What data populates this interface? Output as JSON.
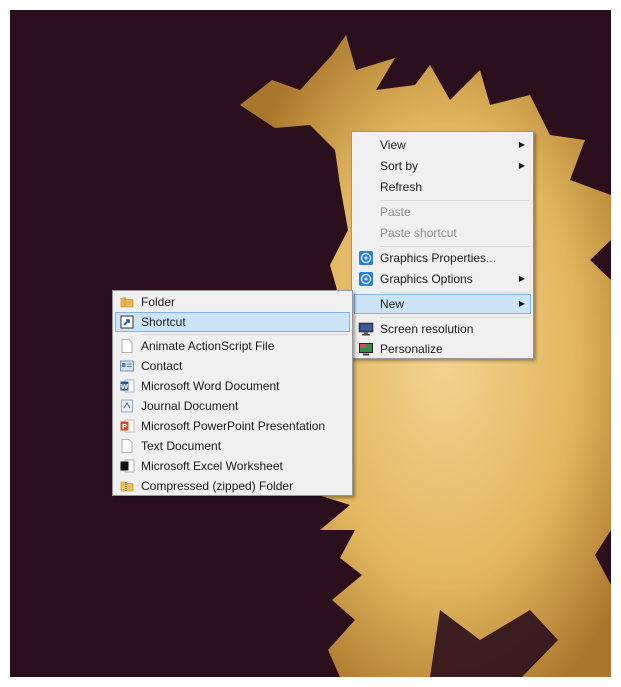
{
  "context_menu": {
    "items": [
      {
        "label": "View",
        "has_submenu": true,
        "enabled": true
      },
      {
        "label": "Sort by",
        "has_submenu": true,
        "enabled": true
      },
      {
        "label": "Refresh",
        "has_submenu": false,
        "enabled": true
      },
      {
        "label": "Paste",
        "has_submenu": false,
        "enabled": false
      },
      {
        "label": "Paste shortcut",
        "has_submenu": false,
        "enabled": false
      },
      {
        "label": "Graphics Properties...",
        "has_submenu": false,
        "enabled": true,
        "icon": "intel-graphics-icon"
      },
      {
        "label": "Graphics Options",
        "has_submenu": true,
        "enabled": true,
        "icon": "intel-graphics-icon"
      },
      {
        "label": "New",
        "has_submenu": true,
        "enabled": true,
        "highlighted": true
      },
      {
        "label": "Screen resolution",
        "has_submenu": false,
        "enabled": true,
        "icon": "monitor-icon"
      },
      {
        "label": "Personalize",
        "has_submenu": false,
        "enabled": true,
        "icon": "personalize-icon"
      }
    ]
  },
  "new_submenu": {
    "items": [
      {
        "label": "Folder",
        "icon": "folder-icon"
      },
      {
        "label": "Shortcut",
        "icon": "shortcut-icon",
        "highlighted": true
      },
      {
        "label": "Animate ActionScript File",
        "icon": "blank-file-icon"
      },
      {
        "label": "Contact",
        "icon": "contact-icon"
      },
      {
        "label": "Microsoft Word Document",
        "icon": "word-doc-icon"
      },
      {
        "label": "Journal Document",
        "icon": "journal-icon"
      },
      {
        "label": "Microsoft PowerPoint Presentation",
        "icon": "powerpoint-icon"
      },
      {
        "label": "Text Document",
        "icon": "text-doc-icon"
      },
      {
        "label": "Microsoft Excel Worksheet",
        "icon": "excel-icon"
      },
      {
        "label": "Compressed (zipped) Folder",
        "icon": "zip-folder-icon"
      }
    ]
  },
  "colors": {
    "desktop_background": "#2b0f1c",
    "wallpaper_shape": "#e0b45c",
    "menu_background": "#f0f0f0",
    "highlight": "#cce4f7",
    "highlight_border": "#7eb4ea"
  }
}
